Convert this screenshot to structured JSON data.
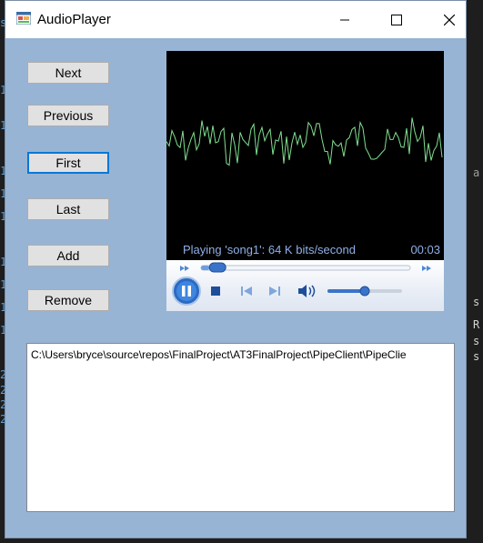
{
  "window": {
    "title": "AudioPlayer"
  },
  "buttons": {
    "next": "Next",
    "previous": "Previous",
    "first": "First",
    "last": "Last",
    "add": "Add",
    "remove": "Remove"
  },
  "player": {
    "status_text": "Playing 'song1': 64 K bits/second",
    "time": "00:03",
    "seek_progress": 0.04,
    "volume_level": 0.5
  },
  "playlist": {
    "items": [
      "C:\\Users\\bryce\\source\\repos\\FinalProject\\AT3FinalProject\\PipeClient\\PipeClie"
    ]
  },
  "background_editor": {
    "fragments": [
      "s",
      "1",
      "1",
      "1",
      "1",
      "1",
      "1",
      "1",
      "1",
      "1",
      "2",
      "2",
      "2",
      "2",
      "a",
      "s",
      "R",
      "s",
      "s"
    ]
  },
  "colors": {
    "window_bg": "#98b4d4",
    "focus_border": "#0078d7",
    "player_text": "#8fb0e6",
    "waveform": "#7fe08f"
  }
}
